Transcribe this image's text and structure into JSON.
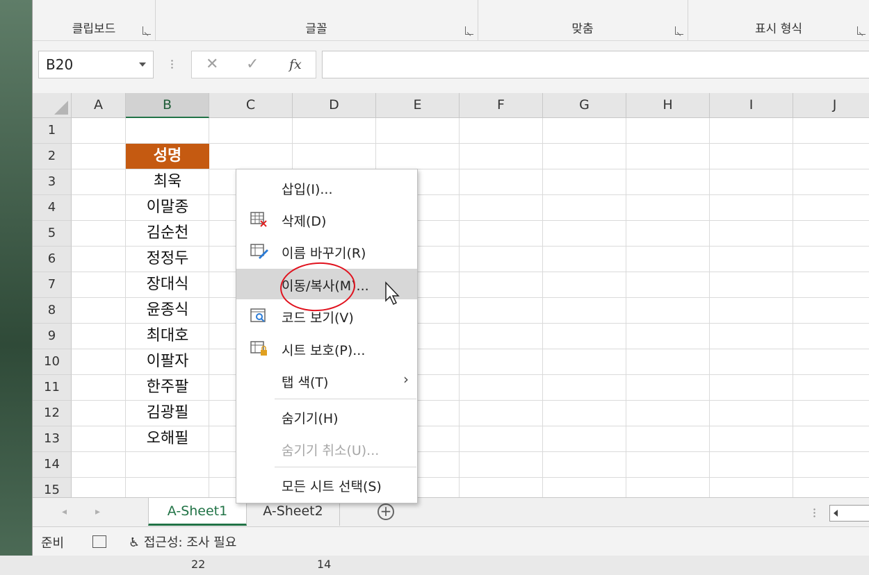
{
  "ribbon": {
    "groups": [
      {
        "label": "클립보드"
      },
      {
        "label": "글꼴"
      },
      {
        "label": "맞춤"
      },
      {
        "label": "표시 형식"
      }
    ]
  },
  "formula_bar": {
    "name_box": "B20",
    "fx_icon": "fx-icon",
    "formula_value": ""
  },
  "grid": {
    "columns": [
      "A",
      "B",
      "C",
      "D",
      "E",
      "F",
      "G",
      "H",
      "I",
      "J"
    ],
    "selected_column": "B",
    "rows": [
      "1",
      "2",
      "3",
      "4",
      "5",
      "6",
      "7",
      "8",
      "9",
      "10",
      "11",
      "12",
      "13",
      "14",
      "15"
    ],
    "header_cell": "성명",
    "header_color": "#c55a11",
    "names": [
      "최욱",
      "이말종",
      "김순천",
      "정정두",
      "장대식",
      "윤종식",
      "최대호",
      "이팔자",
      "한주팔",
      "김광필",
      "오해필"
    ]
  },
  "context_menu": {
    "items": [
      {
        "label": "삽입(I)...",
        "icon": ""
      },
      {
        "label": "삭제(D)",
        "icon": "delete-sheet-icon"
      },
      {
        "label": "이름 바꾸기(R)",
        "icon": "rename-sheet-icon"
      },
      {
        "label": "이동/복사(M)...",
        "icon": "",
        "highlighted": true
      },
      {
        "label": "코드 보기(V)",
        "icon": "view-code-icon"
      },
      {
        "label": "시트 보호(P)...",
        "icon": "protect-sheet-icon"
      },
      {
        "label": "탭 색(T)",
        "icon": "",
        "submenu": true
      },
      {
        "label": "숨기기(H)",
        "icon": ""
      },
      {
        "label": "숨기기 취소(U)...",
        "icon": "",
        "disabled": true
      },
      {
        "label": "모든 시트 선택(S)",
        "icon": ""
      }
    ]
  },
  "sheet_tabs": {
    "tabs": [
      "A-Sheet1",
      "A-Sheet2"
    ],
    "active": "A-Sheet1",
    "accent": "#217346"
  },
  "status_bar": {
    "ready": "준비",
    "accessibility": "접근성: 조사 필요"
  },
  "background_sheet": {
    "row_label_a": "22",
    "row_label_b": "14"
  }
}
